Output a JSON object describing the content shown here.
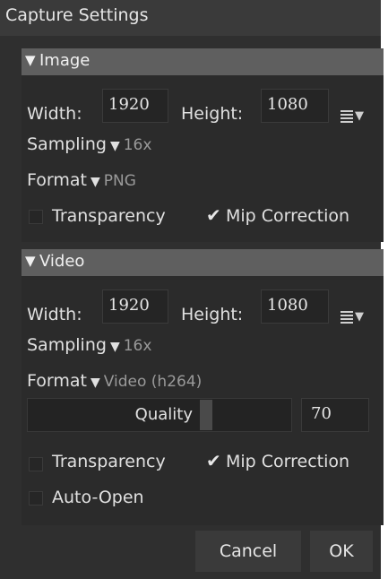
{
  "window": {
    "title": "Capture Settings"
  },
  "image": {
    "header": "Image",
    "width_label": "Width:",
    "width_value": "1920",
    "height_label": "Height:",
    "height_value": "1080",
    "sampling_label": "Sampling",
    "sampling_value": "16x",
    "format_label": "Format",
    "format_value": "PNG",
    "transparency_label": "Transparency",
    "mip_label": "Mip Correction",
    "transparency_checked": false,
    "mip_checked": true
  },
  "video": {
    "header": "Video",
    "width_label": "Width:",
    "width_value": "1920",
    "height_label": "Height:",
    "height_value": "1080",
    "sampling_label": "Sampling",
    "sampling_value": "16x",
    "format_label": "Format",
    "format_value": "Video (h264)",
    "quality_label": "Quality",
    "quality_value": "70",
    "transparency_label": "Transparency",
    "mip_label": "Mip Correction",
    "autoopen_label": "Auto-Open",
    "transparency_checked": false,
    "mip_checked": true,
    "autoopen_checked": false
  },
  "footer": {
    "cancel_label": "Cancel",
    "ok_label": "OK"
  },
  "icons": {
    "collapse": "triangle-down-icon",
    "dropdown": "triangle-down-icon",
    "presets": "list-menu-icon",
    "check": "checkmark-icon"
  },
  "colors": {
    "background": "#2f2f2f",
    "section_header": "#5f5f5f",
    "input_bg": "#252525",
    "dim_text": "#9a9a9a"
  }
}
